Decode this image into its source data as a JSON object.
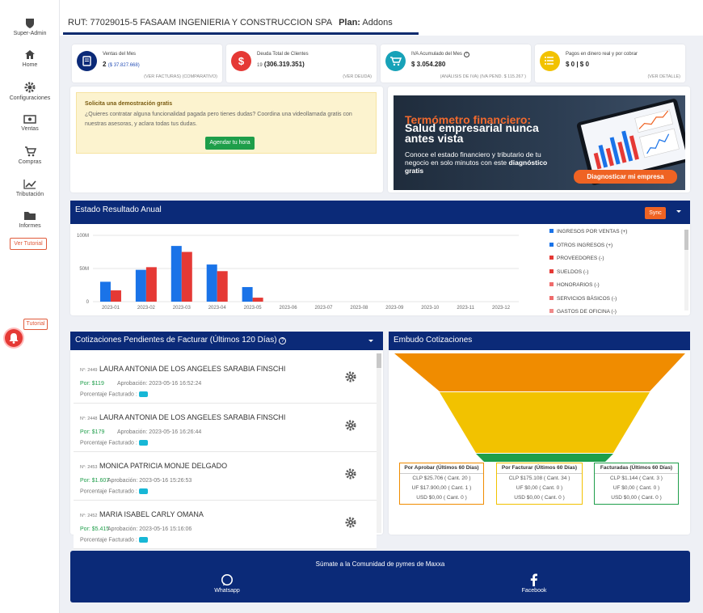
{
  "sidebar": {
    "items": [
      {
        "label": "Super-Admin",
        "icon": "shield-icon"
      },
      {
        "label": "Home",
        "icon": "home-icon"
      },
      {
        "label": "Configuraciones",
        "icon": "gear-icon"
      },
      {
        "label": "Ventas",
        "icon": "cash-icon"
      },
      {
        "label": "Compras",
        "icon": "cart-icon"
      },
      {
        "label": "Tributación",
        "icon": "chart-line-icon"
      },
      {
        "label": "Informes",
        "icon": "folder-icon"
      }
    ],
    "tutorial_button": "Ver Tutorial",
    "tutorial_float": "Tutorial"
  },
  "header": {
    "rut": "RUT: 77029015-5 FASAAM INGENIERIA Y CONSTRUCCION SPA",
    "plan_label": "Plan:",
    "plan_value": "Addons"
  },
  "kpis": [
    {
      "label": "Ventas del Mes",
      "value": "2",
      "sub": "($ 37.827.668)",
      "link": "(VER FACTURAS) (COMPARATIVO)",
      "color": "#0b2a78",
      "icon": "book-icon"
    },
    {
      "label": "Deuda Total de Clientes",
      "value": "(306.319.351)",
      "sub_prefix": "19",
      "link": "(VER DEUDA)",
      "color": "#e53935",
      "icon": "dollar-icon"
    },
    {
      "label": "IVA Acumulado del Mes",
      "value": "$ 3.054.280",
      "link": "(ANÁLISIS DE IVA) (IVA PEND. $ 115.267 )",
      "color": "#17a2b8",
      "icon": "cart-icon"
    },
    {
      "label": "Pagos en dinero real y por cobrar",
      "value": "$ 0 | $ 0",
      "link": "(VER DETALLE)",
      "color": "#f2c200",
      "icon": "list-icon"
    }
  ],
  "demo": {
    "title": "Solicita una demostración gratis",
    "text": "¿Quieres contratar alguna funcionalidad pagada pero tienes dudas? Coordina una videollamada gratis con nuestras asesoras, y aclara todas tus dudas.",
    "button": "Agendar tu hora"
  },
  "banner": {
    "line1": "Termómetro financiero:",
    "line2": "Salud empresarial nunca antes vista",
    "line3": "Conoce el estado financiero y tributario de tu negocio en solo minutos con este",
    "line3_bold": "diagnóstico gratis",
    "button": "Diagnosticar mi empresa"
  },
  "annual": {
    "title": "Estado Resultado Anual",
    "sync": "Sync",
    "legend": [
      {
        "name": "INGRESOS POR VENTAS (+)",
        "color": "#1a73e8"
      },
      {
        "name": "OTROS INGRESOS (+)",
        "color": "#1a73e8"
      },
      {
        "name": "PROVEEDORES (-)",
        "color": "#e53935"
      },
      {
        "name": "SUELDOS (-)",
        "color": "#e53935"
      },
      {
        "name": "HONORARIOS (-)",
        "color": "#ef6b6b"
      },
      {
        "name": "SERVICIOS BÁSICOS (-)",
        "color": "#ef6b6b"
      },
      {
        "name": "GASTOS DE OFICINA (-)",
        "color": "#ef8a8a"
      }
    ]
  },
  "chart_data": {
    "type": "bar",
    "categories": [
      "2023-01",
      "2023-02",
      "2023-03",
      "2023-04",
      "2023-05",
      "2023-06",
      "2023-07",
      "2023-08",
      "2023-09",
      "2023-10",
      "2023-11",
      "2023-12"
    ],
    "yticks": [
      "0",
      "50M",
      "100M"
    ],
    "ylim": [
      0,
      100000000
    ],
    "series": [
      {
        "name": "INGRESOS POR VENTAS (+)",
        "color": "#1a73e8",
        "values": [
          30000000,
          48000000,
          84000000,
          56000000,
          22000000,
          0,
          0,
          0,
          0,
          0,
          0,
          0
        ]
      },
      {
        "name": "PROVEEDORES (-)",
        "color": "#e53935",
        "values": [
          17000000,
          52000000,
          75000000,
          46000000,
          6000000,
          0,
          0,
          0,
          0,
          0,
          0,
          0
        ]
      }
    ]
  },
  "quotes": {
    "title": "Cotizaciones Pendientes de Facturar (Últimos 120 Días)",
    "items": [
      {
        "num": "N°: 2449",
        "name": "LAURA ANTONIA DE LOS ANGELES SARABIA FINSCHI",
        "por": "Por: $119",
        "date": "Aprobación: 2023-05-16 16:52:24",
        "pct": "Porcentaje Facturado :"
      },
      {
        "num": "N°: 2448",
        "name": "LAURA ANTONIA DE LOS ANGELES SARABIA FINSCHI",
        "por": "Por: $179",
        "date": "Aprobación: 2023-05-16 16:26:44",
        "pct": "Porcentaje Facturado :"
      },
      {
        "num": "N°: 2453",
        "name": "MONICA PATRICIA MONJE DELGADO",
        "por": "Por: $1.607",
        "date": "Aprobación: 2023-05-16 15:26:53",
        "pct": "Porcentaje Facturado :"
      },
      {
        "num": "N°: 2452",
        "name": "MARIA ISABEL CARLY OMANA",
        "por": "Por: $5.415",
        "date": "Aprobación: 2023-05-16 15:16:06",
        "pct": "Porcentaje Facturado :"
      }
    ]
  },
  "funnel": {
    "title": "Embudo Cotizaciones",
    "boxes": [
      {
        "head": "Por Aprobar (Últimos 60 Días)",
        "l1": "CLP $25.706 ( Cant. 20 )",
        "l2": "UF $17.900,00 ( Cant. 1 )",
        "l3": "USD $0,00 ( Cant. 0 )",
        "color": "#f08c00"
      },
      {
        "head": "Por Facturar (Últimos 60 Días)",
        "l1": "CLP $175.108 ( Cant. 34 )",
        "l2": "UF $0,00 ( Cant. 0 )",
        "l3": "USD $0,00 ( Cant. 0 )",
        "color": "#f2c200"
      },
      {
        "head": "Facturadas (Últimos 60 Días)",
        "l1": "CLP $1.144 ( Cant. 3 )",
        "l2": "UF $0,00 ( Cant. 0 )",
        "l3": "USD $0,00 ( Cant. 0 )",
        "color": "#1e9e4a"
      }
    ]
  },
  "footer": {
    "title": "Súmate a la Comunidad de pymes de Maxxa",
    "whatsapp": "Whatsapp",
    "facebook": "Facebook"
  }
}
